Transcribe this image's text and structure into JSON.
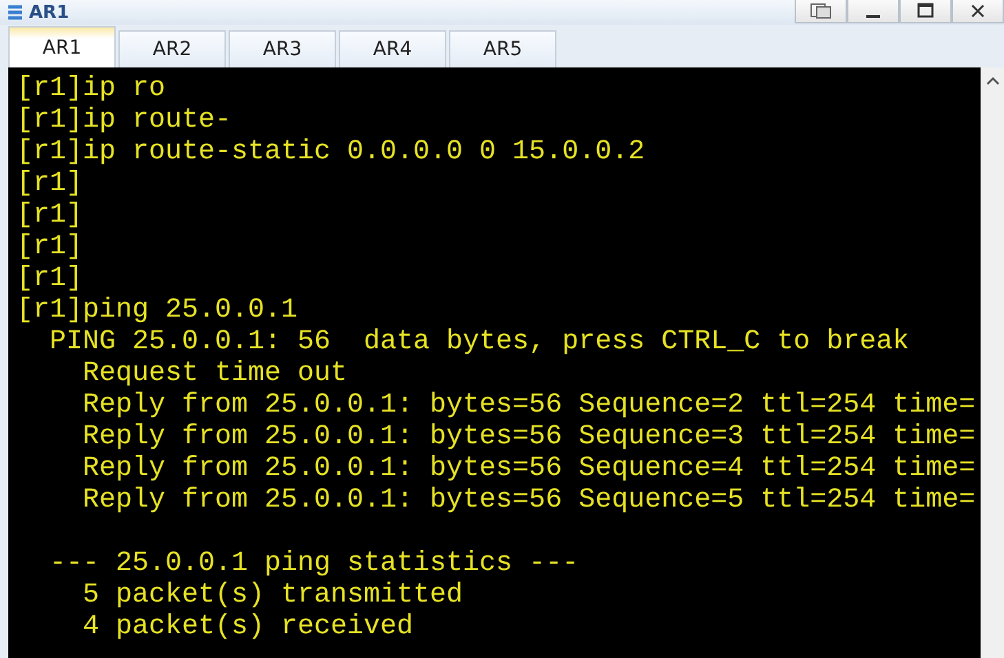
{
  "window": {
    "title": "AR1"
  },
  "tabs": [
    {
      "label": "AR1",
      "selected": true
    },
    {
      "label": "AR2",
      "selected": false
    },
    {
      "label": "AR3",
      "selected": false
    },
    {
      "label": "AR4",
      "selected": false
    },
    {
      "label": "AR5",
      "selected": false
    }
  ],
  "terminal": {
    "blocks": [
      {
        "lines": [
          "[r1]ip ro",
          "[r1]ip route-",
          "[r1]ip route-static 0.0.0.0 0 15.0.0.2",
          "[r1]",
          "[r1]",
          "[r1]",
          "[r1]",
          "[r1]ping 25.0.0.1",
          "  PING 25.0.0.1: 56  data bytes, press CTRL_C to break",
          "    Request time out",
          "    Reply from 25.0.0.1: bytes=56 Sequence=2 ttl=254 time=",
          "    Reply from 25.0.0.1: bytes=56 Sequence=3 ttl=254 time=",
          "    Reply from 25.0.0.1: bytes=56 Sequence=4 ttl=254 time=",
          "    Reply from 25.0.0.1: bytes=56 Sequence=5 ttl=254 time="
        ]
      },
      {
        "lines": [
          "  --- 25.0.0.1 ping statistics ---",
          "    5 packet(s) transmitted",
          "    4 packet(s) received"
        ]
      }
    ]
  }
}
